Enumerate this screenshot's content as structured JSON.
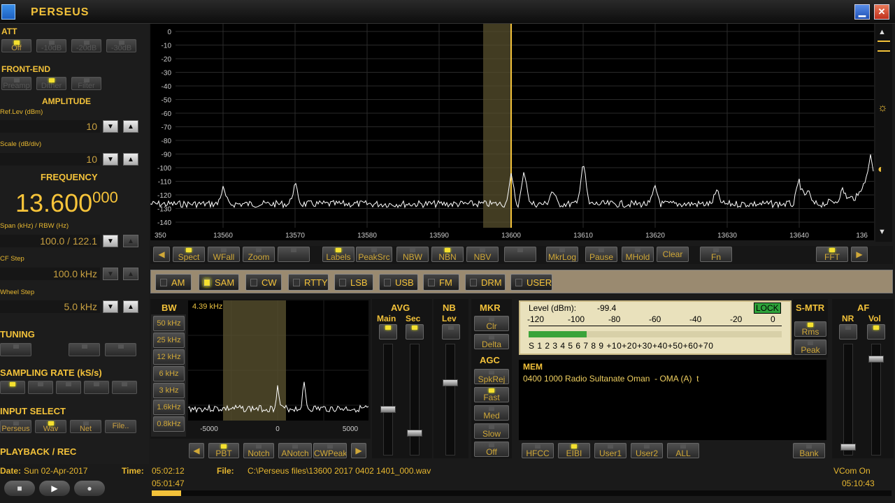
{
  "title": "PERSEUS",
  "left": {
    "att": "ATT",
    "att_btns": [
      "Off",
      "-10dB",
      "-20dB",
      "-30dB"
    ],
    "frontend": "FRONT-END",
    "frontend_btns": [
      "Preamp",
      "Dither",
      "Filter"
    ],
    "amplitude": "AMPLITUDE",
    "ref_label": "Ref.Lev (dBm)",
    "ref_value": "10",
    "scale_label": "Scale (dB/div)",
    "scale_value": "10",
    "frequency": "FREQUENCY",
    "freq_main": "13.600",
    "freq_sub": "000",
    "span_label": "Span (kHz) / RBW (Hz)",
    "span_value": "100.0 / 122.1",
    "cfstep_label": "CF Step",
    "cfstep_value": "100.0 kHz",
    "wheel_label": "Wheel Step",
    "wheel_value": "5.0 kHz",
    "tuning": "TUNING",
    "sampling": "SAMPLING RATE (kS/s)",
    "input": "INPUT SELECT",
    "input_btns": [
      "Perseus",
      "Wav",
      "Net",
      "File.."
    ],
    "playback": "PLAYBACK / REC"
  },
  "spectrum": {
    "y_ticks": [
      "0",
      "-10",
      "-20",
      "-30",
      "-40",
      "-50",
      "-60",
      "-70",
      "-80",
      "-90",
      "-100",
      "-110",
      "-120",
      "-130",
      "-140"
    ],
    "x_ticks": [
      "350",
      "13560",
      "13570",
      "13580",
      "13590",
      "13600",
      "13610",
      "13620",
      "13630",
      "13640",
      "136"
    ]
  },
  "spec_btns": [
    "Spect",
    "WFall",
    "Zoom",
    "Labels",
    "PeakSrc",
    "NBW",
    "NBN",
    "NBV",
    "MkrLog",
    "Pause",
    "MHold",
    "Clear",
    "Fn",
    "FFT"
  ],
  "modes": [
    "AM",
    "SAM",
    "CW",
    "RTTY",
    "LSB",
    "USB",
    "FM",
    "DRM",
    "USER"
  ],
  "active_mode": "SAM",
  "bw": {
    "label": "BW",
    "value": "4.39 kHz",
    "btns": [
      "50 kHz",
      "25 kHz",
      "12 kHz",
      "6 kHz",
      "3 kHz",
      "1.6kHz",
      "0.8kHz"
    ],
    "x_ticks": [
      "-5000",
      "0",
      "5000"
    ]
  },
  "bw_btns": [
    "PBT",
    "Notch",
    "ANotch",
    "CWPeak"
  ],
  "avg": {
    "label": "AVG",
    "main": "Main",
    "sec": "Sec"
  },
  "nb": {
    "label": "NB",
    "lev": "Lev"
  },
  "mkr": {
    "label": "MKR",
    "btns": [
      "Clr",
      "Delta"
    ]
  },
  "agc": {
    "label": "AGC",
    "btns": [
      "SpkRej",
      "Fast",
      "Med",
      "Slow",
      "Off"
    ]
  },
  "meter": {
    "level_label": "Level (dBm):",
    "level_value": "-99.4",
    "lock": "LOCK",
    "top_scale": [
      "-120",
      "-100",
      "-80",
      "-60",
      "-40",
      "-20",
      "0"
    ],
    "bottom_scale": "S 1 2 3 4 5 6 7 8 9 +10+20+30+40+50+60+70",
    "bar_fraction": 0.23
  },
  "smtr": {
    "label": "S-MTR",
    "btns": [
      "Rms",
      "Peak"
    ]
  },
  "af": {
    "label": "AF",
    "nr": "NR",
    "vol": "Vol"
  },
  "mem": {
    "label": "MEM",
    "line": "0400 1000 Radio Sultanate Oman  - OMA (A)  t"
  },
  "mem_btns": [
    "HFCC",
    "EIBI",
    "User1",
    "User2",
    "ALL",
    "Bank"
  ],
  "status": {
    "date_label": "Date:",
    "date": "Sun 02-Apr-2017",
    "time_label": "Time:",
    "time": "05:02:12",
    "file_label": "File:",
    "file": "C:\\Perseus files\\13600 2017 0402 1401_000.wav",
    "vcom": "VCom On",
    "elapsed": "05:01:47",
    "total": "05:10:43",
    "progress": 0.04
  }
}
